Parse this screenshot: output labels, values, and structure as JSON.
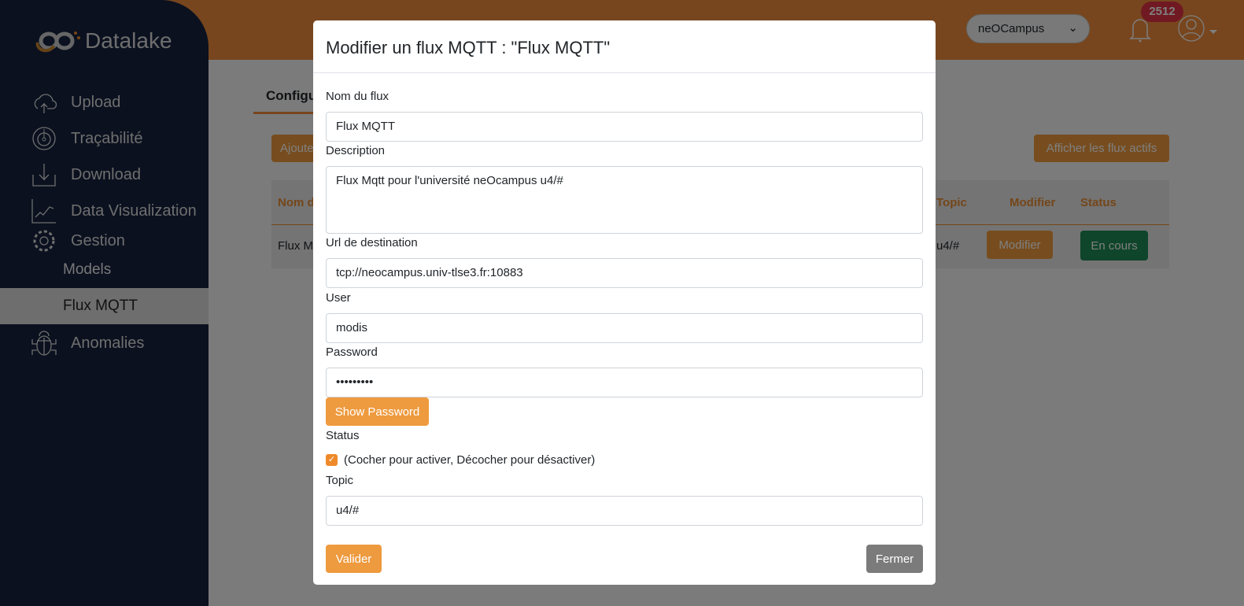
{
  "sidebar": {
    "logo": "Datalake",
    "items": [
      {
        "label": "Upload",
        "icon": "cloud-upload-icon"
      },
      {
        "label": "Traçabilité",
        "icon": "radar-icon"
      },
      {
        "label": "Download",
        "icon": "download-icon"
      },
      {
        "label": "Data Visualization",
        "icon": "chart-icon"
      },
      {
        "label": "Gestion",
        "icon": "gear-icon"
      }
    ],
    "sub": [
      "Models",
      "Flux MQTT"
    ],
    "anomalies": "Anomalies"
  },
  "header": {
    "selector": "neOCampus",
    "notifications": "2512"
  },
  "main": {
    "tab": "Configu",
    "add_button": "Ajoute",
    "show_active": "Afficher les flux actifs",
    "columns": [
      "Nom d",
      "Topic",
      "Modifier",
      "Status"
    ],
    "row": {
      "name": "Flux M",
      "topic": "u4/#",
      "modify": "Modifier",
      "status": "En cours"
    }
  },
  "modal": {
    "title": "Modifier un flux MQTT : \"Flux MQTT\"",
    "name_label": "Nom du flux",
    "name": "Flux MQTT",
    "desc_label": "Description",
    "desc": "Flux Mqtt pour l'université neOcampus u4/#",
    "url_label": "Url de destination",
    "url": "tcp://neocampus.univ-tlse3.fr:10883",
    "user_label": "User",
    "user": "modis",
    "pass_label": "Password",
    "pass": "•••••••••",
    "show_pass": "Show Password",
    "status_label": "Status",
    "status_checked": true,
    "status_text": "(Cocher pour activer, Décocher pour désactiver)",
    "topic_label": "Topic",
    "topic": "u4/#",
    "submit": "Valider",
    "close": "Fermer"
  },
  "colors": {
    "accent": "#ee9a3e",
    "sidebar": "#16233f",
    "success": "#198754"
  }
}
